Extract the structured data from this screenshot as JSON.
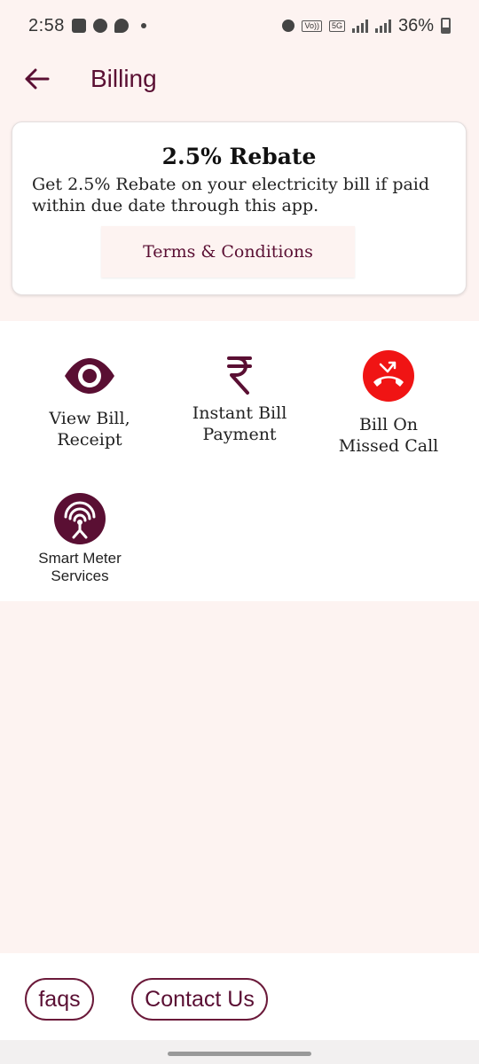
{
  "status_bar": {
    "time": "2:58",
    "battery": "36%",
    "network": "5G",
    "volte": "Vo))"
  },
  "header": {
    "title": "Billing"
  },
  "rebate": {
    "title": "2.5% Rebate",
    "description": "Get 2.5% Rebate on your electricity bill if paid within due date through this app.",
    "terms_label": "Terms & Conditions"
  },
  "services": {
    "view_bill": "View Bill,\nReceipt",
    "instant_payment": "Instant Bill\nPayment",
    "missed_call": "Bill On\nMissed Call",
    "smart_meter": "Smart Meter\nServices"
  },
  "footer": {
    "faqs_label": "faqs",
    "contact_label": "Contact Us"
  },
  "colors": {
    "brand": "#5a0f33",
    "background": "#fdf3f1",
    "missed_call_red": "#f01414"
  },
  "icons": {
    "back": "arrow-left-icon",
    "view_bill": "eye-icon",
    "payment": "rupee-icon",
    "missed_call": "missed-call-icon",
    "smart_meter": "antenna-icon"
  }
}
